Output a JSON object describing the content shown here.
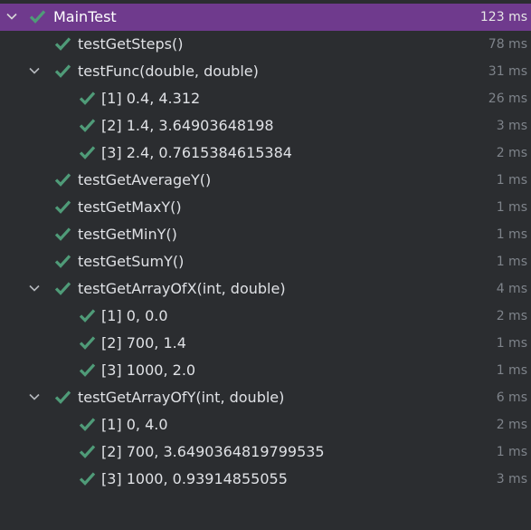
{
  "colors": {
    "background": "#2b2d30",
    "selected": "#6f3a8d",
    "check": "#4f9b78",
    "text": "#dfe1e5",
    "time": "#7e838a"
  },
  "tests": [
    {
      "label": "MainTest",
      "time": "123 ms",
      "level": 0,
      "expandable": true,
      "selected": true
    },
    {
      "label": "testGetSteps()",
      "time": "78 ms",
      "level": 1,
      "expandable": false
    },
    {
      "label": "testFunc(double, double)",
      "time": "31 ms",
      "level": 1,
      "expandable": true
    },
    {
      "label": "[1] 0.4, 4.312",
      "time": "26 ms",
      "level": 2,
      "expandable": false
    },
    {
      "label": "[2] 1.4, 3.64903648198",
      "time": "3 ms",
      "level": 2,
      "expandable": false
    },
    {
      "label": "[3] 2.4, 0.7615384615384",
      "time": "2 ms",
      "level": 2,
      "expandable": false
    },
    {
      "label": "testGetAverageY()",
      "time": "1 ms",
      "level": 1,
      "expandable": false
    },
    {
      "label": "testGetMaxY()",
      "time": "1 ms",
      "level": 1,
      "expandable": false
    },
    {
      "label": "testGetMinY()",
      "time": "1 ms",
      "level": 1,
      "expandable": false
    },
    {
      "label": "testGetSumY()",
      "time": "1 ms",
      "level": 1,
      "expandable": false
    },
    {
      "label": "testGetArrayOfX(int, double)",
      "time": "4 ms",
      "level": 1,
      "expandable": true
    },
    {
      "label": "[1] 0, 0.0",
      "time": "2 ms",
      "level": 2,
      "expandable": false
    },
    {
      "label": "[2] 700, 1.4",
      "time": "1 ms",
      "level": 2,
      "expandable": false
    },
    {
      "label": "[3] 1000, 2.0",
      "time": "1 ms",
      "level": 2,
      "expandable": false
    },
    {
      "label": "testGetArrayOfY(int, double)",
      "time": "6 ms",
      "level": 1,
      "expandable": true
    },
    {
      "label": "[1] 0, 4.0",
      "time": "2 ms",
      "level": 2,
      "expandable": false
    },
    {
      "label": "[2] 700, 3.6490364819799535",
      "time": "1 ms",
      "level": 2,
      "expandable": false
    },
    {
      "label": "[3] 1000, 0.93914855055",
      "time": "3 ms",
      "level": 2,
      "expandable": false
    }
  ]
}
